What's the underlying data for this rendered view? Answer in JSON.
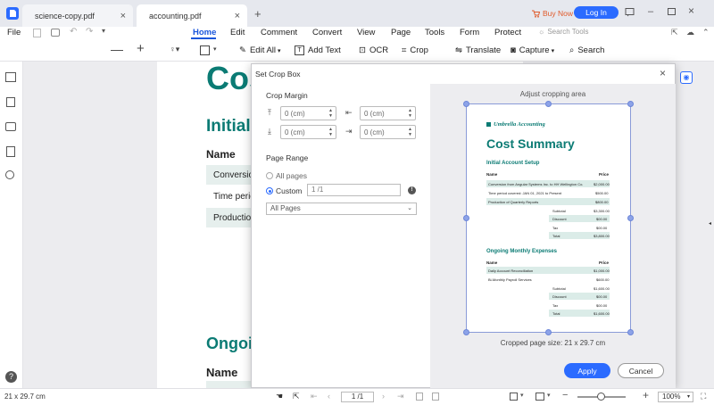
{
  "tabs": [
    {
      "label": "science-copy.pdf"
    },
    {
      "label": "accounting.pdf"
    }
  ],
  "titlebar": {
    "buy_now": "Buy Now",
    "login": "Log In"
  },
  "menu": {
    "file": "File",
    "items": [
      "Home",
      "Edit",
      "Comment",
      "Convert",
      "View",
      "Page",
      "Tools",
      "Form",
      "Protect"
    ],
    "search_tools": "Search Tools",
    "active": "Home"
  },
  "toolbar": {
    "edit_all": "Edit All",
    "add_text": "Add Text",
    "ocr": "OCR",
    "crop": "Crop",
    "translate": "Translate",
    "capture": "Capture",
    "search": "Search"
  },
  "document": {
    "big_title": "Cos",
    "section1": "Initial",
    "name_header": "Name",
    "rows": [
      "Conversion",
      "Time perio",
      "Production"
    ],
    "section2": "Ongoin",
    "name_header2": "Name"
  },
  "dialog": {
    "title": "Set Crop Box",
    "crop_margin": "Crop Margin",
    "margins": {
      "top": "0 (cm)",
      "left": "0 (cm)",
      "bottom": "0 (cm)",
      "right": "0 (cm)"
    },
    "page_range": "Page Range",
    "all_pages_radio": "All pages",
    "custom_radio": "Custom",
    "custom_value": "1 /1",
    "pages_select": "All Pages",
    "adjust_label": "Adjust cropping area",
    "cropped_size": "Cropped page size: 21 x 29.7 cm",
    "apply": "Apply",
    "cancel": "Cancel"
  },
  "preview_doc": {
    "brand": "Umbrella Accounting",
    "title": "Cost Summary",
    "section1": "Initial Account Setup",
    "col_name": "Name",
    "col_price": "Price",
    "rows1": [
      {
        "name": "Conversion from Angular Systems Inc. to HH Wellington Co.",
        "price": "$2,000.00"
      },
      {
        "name": "Time period covered: JAN 01, 2021 to Present",
        "price": "$500.00"
      },
      {
        "name": "Production of Quarterly Reports",
        "price": "$800.00"
      }
    ],
    "totals1": [
      {
        "label": "Subtotal",
        "value": "$3,300.00"
      },
      {
        "label": "Discount",
        "value": "$00.00"
      },
      {
        "label": "Tax",
        "value": "$00.00"
      },
      {
        "label": "Total",
        "value": "$3,800.00"
      }
    ],
    "section2": "Ongoing Monthly Expenses",
    "rows2": [
      {
        "name": "Daily Account Reconciliation",
        "price": "$1,000.00"
      },
      {
        "name": "Bi-Monthly Payroll Services",
        "price": "$600.00"
      }
    ],
    "totals2": [
      {
        "label": "Subtotal",
        "value": "$1,600.00"
      },
      {
        "label": "Discount",
        "value": "$00.00"
      },
      {
        "label": "Tax",
        "value": "$00.00"
      },
      {
        "label": "Total",
        "value": "$1,600.00"
      }
    ]
  },
  "statusbar": {
    "page_size": "21 x 29.7 cm",
    "page_input": "1 /1",
    "zoom": "100%",
    "zoom_level": 0.5
  }
}
